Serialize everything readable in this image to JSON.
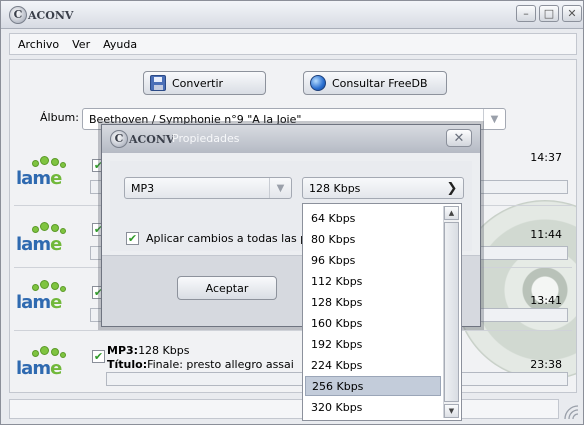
{
  "app": {
    "logo_text": "ACONV",
    "menu": [
      "Archivo",
      "Ver",
      "Ayuda"
    ]
  },
  "toolbar": {
    "convert_label": "Convertir",
    "freedb_label": "Consultar FreeDB"
  },
  "album": {
    "label": "Álbum:",
    "value": "Beethoven / Symphonie n°9 \"A la Joie\""
  },
  "tracks": [
    {
      "time": "14:37",
      "checked": true
    },
    {
      "time": "11:44",
      "checked": true
    },
    {
      "time": "13:41",
      "checked": true
    },
    {
      "time": "23:38",
      "checked": true,
      "format_key": "MP3:",
      "format_value": "128 Kbps",
      "title_key": "Título:",
      "title_value": "Finale: presto allegro assai"
    }
  ],
  "dialog": {
    "logo_text": "ACONV",
    "title": "Propiedades",
    "format_value": "MP3",
    "bitrate_value": "128 Kbps",
    "apply_all_label": "Aplicar cambios a todas las pis",
    "accept_label": "Aceptar"
  },
  "bitrate_options": [
    {
      "label": "64 Kbps",
      "selected": false
    },
    {
      "label": "80 Kbps",
      "selected": false
    },
    {
      "label": "96 Kbps",
      "selected": false
    },
    {
      "label": "112 Kbps",
      "selected": false
    },
    {
      "label": "128 Kbps",
      "selected": false
    },
    {
      "label": "160 Kbps",
      "selected": false
    },
    {
      "label": "192 Kbps",
      "selected": false
    },
    {
      "label": "224 Kbps",
      "selected": false
    },
    {
      "label": "256 Kbps",
      "selected": true
    },
    {
      "label": "320 Kbps",
      "selected": false
    }
  ],
  "colors": {
    "lame_blue": "#2f6ab0",
    "lame_green": "#7fc440",
    "check_green": "#2f9a28",
    "selection": "#c3ccda"
  }
}
